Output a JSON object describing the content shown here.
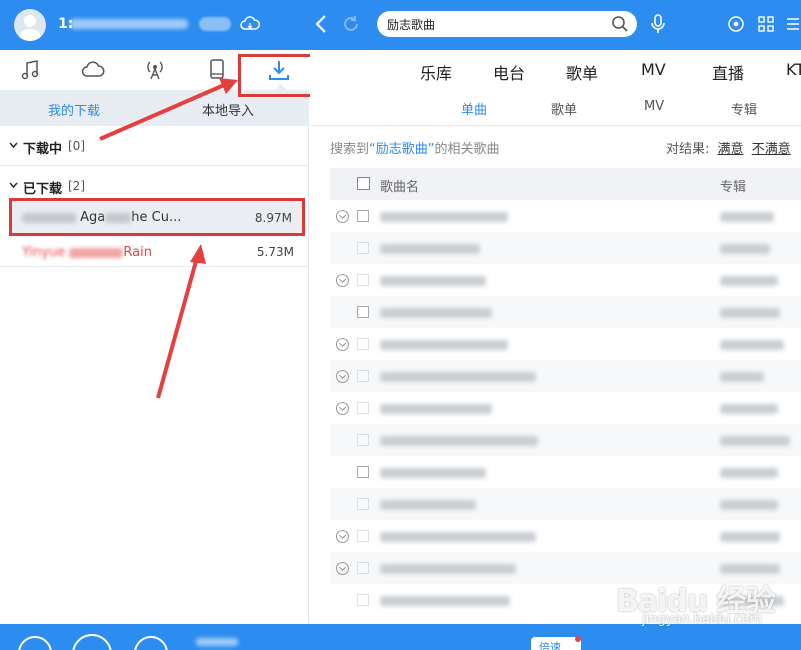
{
  "titlebar": {
    "username": "1:",
    "search_value": "励志歌曲"
  },
  "left": {
    "subtabs": {
      "mine": "我的下载",
      "local": "本地导入"
    },
    "downloading": {
      "title": "下载中",
      "count": "[0]"
    },
    "downloaded": {
      "title": "已下载",
      "count": "[2]"
    },
    "rows": [
      {
        "name_a": "Aga",
        "name_b": "he Cu...",
        "size": "8.97M"
      },
      {
        "name_a": "Yinyue",
        "name_b": "Rain",
        "size": "5.73M"
      }
    ]
  },
  "right": {
    "main_tabs": [
      "乐库",
      "电台",
      "歌单",
      "MV",
      "直播",
      "KT"
    ],
    "sub_nav": [
      "单曲",
      "歌单",
      "MV",
      "专辑"
    ],
    "result": {
      "prefix": "搜索到",
      "keyword": "“励志歌曲”",
      "suffix": "的相关歌曲"
    },
    "feedback": {
      "label": "对结果:",
      "good": "满意",
      "bad": "不满意"
    },
    "table": {
      "col_song": "歌曲名",
      "col_album": "专辑"
    }
  },
  "player": {
    "speed": "倍速"
  },
  "watermark": {
    "logo": "Baidu 经验",
    "url": "jingyan.baidu.com"
  },
  "colors": {
    "accent": "#2c8cf0",
    "annotation": "#d93a3a",
    "playing": "#e6474b"
  }
}
